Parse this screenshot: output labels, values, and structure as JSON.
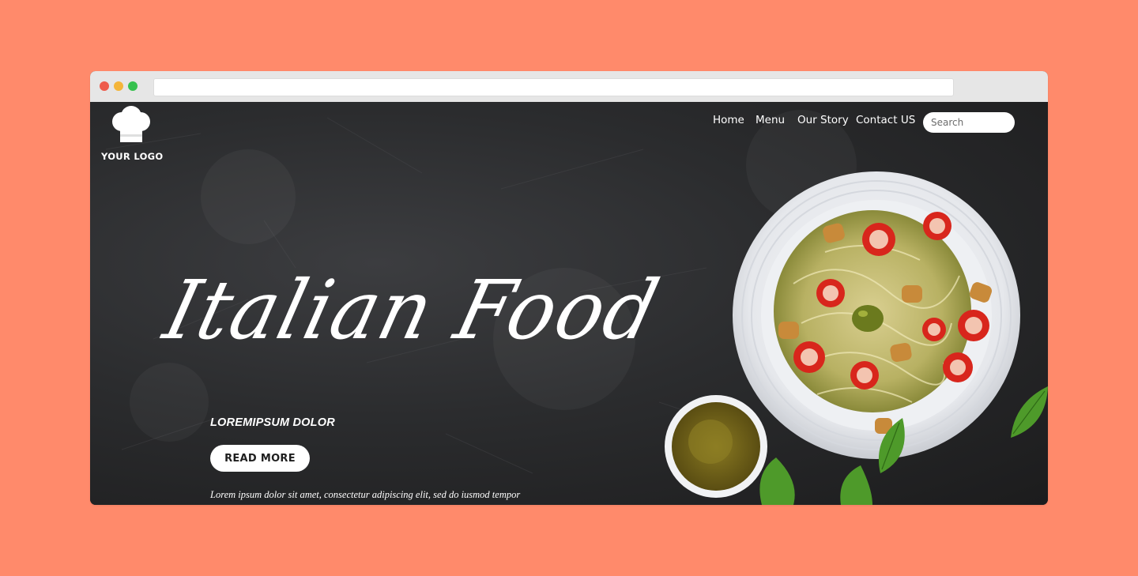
{
  "window": {
    "controls": [
      "close",
      "minimize",
      "maximize"
    ],
    "address": ""
  },
  "logo": {
    "icon": "chef-hat-icon",
    "text": "YOUR LOGO"
  },
  "nav": {
    "items": [
      {
        "label": "Home"
      },
      {
        "label": "Menu"
      },
      {
        "label": "Our Story"
      },
      {
        "label": "Contact US"
      }
    ],
    "search_placeholder": "Search"
  },
  "hero": {
    "title": "Italian Food",
    "subtitle": "LOREMIPSUM DOLOR",
    "button_label": "READ MORE",
    "body": "Lorem ipsum dolor sit amet, consectetur adipiscing elit, sed do iusmod tempor"
  },
  "colors": {
    "page_background": "#ff8a6b",
    "hero_background": "#2b2c2e",
    "text": "#ffffff",
    "window_close": "#ee5b4c",
    "window_minimize": "#f4b53a",
    "window_maximize": "#37c14f"
  }
}
